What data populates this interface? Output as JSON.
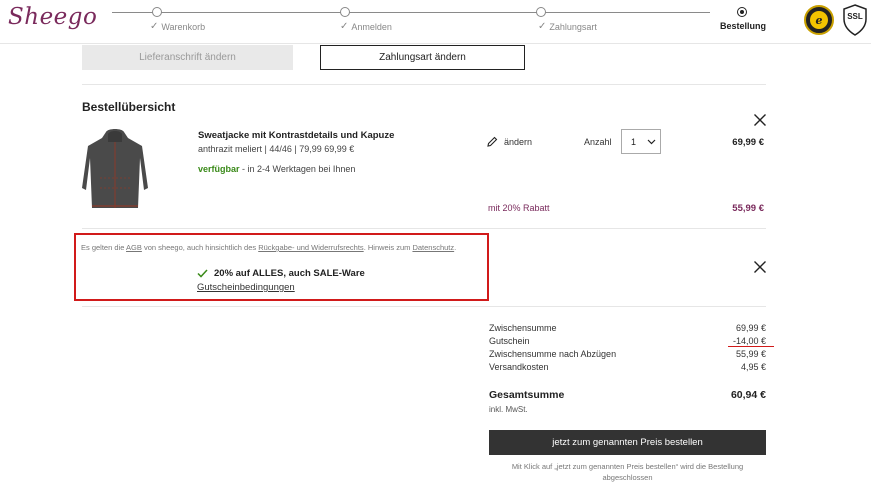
{
  "brand": {
    "logo_text": "Sheego"
  },
  "steps": [
    {
      "label": "Warenkorb",
      "done": true
    },
    {
      "label": "Anmelden",
      "done": true
    },
    {
      "label": "Zahlungsart",
      "done": true
    },
    {
      "label": "Bestellung",
      "done": false,
      "active": true
    }
  ],
  "badges": {
    "ssl": "SSL",
    "trusted": "e"
  },
  "buttons": {
    "change_address": "Lieferanschrift ändern",
    "change_payment": "Zahlungsart ändern"
  },
  "overview": {
    "title": "Bestellübersicht",
    "product": {
      "name": "Sweatjacke mit Kontrastdetails und Kapuze",
      "meta": "anthrazit meliert | 44/46 | 79,99 69,99 €",
      "availability_status": "verfügbar",
      "availability_text": " - in 2-4 Werktagen bei Ihnen",
      "edit_label": "ändern",
      "quantity_label": "Anzahl",
      "quantity_value": "1",
      "price": "69,99 €",
      "discount_label": "mit 20% Rabatt",
      "discount_price": "55,99 €"
    }
  },
  "voucher": {
    "agb_prefix": "Es gelten die ",
    "agb_link": "AGB",
    "agb_mid": " von sheego, auch hinsichtlich des ",
    "agb_link2": "Rückgabe- und Widerrufsrechts",
    "agb_mid2": ". Hinweis zum ",
    "agb_link3": "Datenschutz",
    "agb_end": ".",
    "title": "20% auf ALLES, auch SALE-Ware",
    "conditions_link": "Gutscheinbedingungen"
  },
  "summary": {
    "rows": [
      {
        "label": "Zwischensumme",
        "value": "69,99 €"
      },
      {
        "label": "Gutschein",
        "value": "-14,00 €"
      },
      {
        "label": "Zwischensumme nach Abzügen",
        "value": "55,99 €"
      },
      {
        "label": "Versandkosten",
        "value": "4,95 €"
      }
    ],
    "total_label": "Gesamtsumme",
    "total_value": "60,94 €",
    "vat_note": "inkl. MwSt.",
    "order_button": "jetzt zum genannten Preis bestellen",
    "order_note": "Mit Klick auf „jetzt zum genannten Preis bestellen“ wird die Bestellung abgeschlossen"
  },
  "colors": {
    "brand": "#7a2a5c",
    "available": "#3a8a19",
    "highlight_border": "#d11a1a",
    "order_button_bg": "#333333"
  }
}
